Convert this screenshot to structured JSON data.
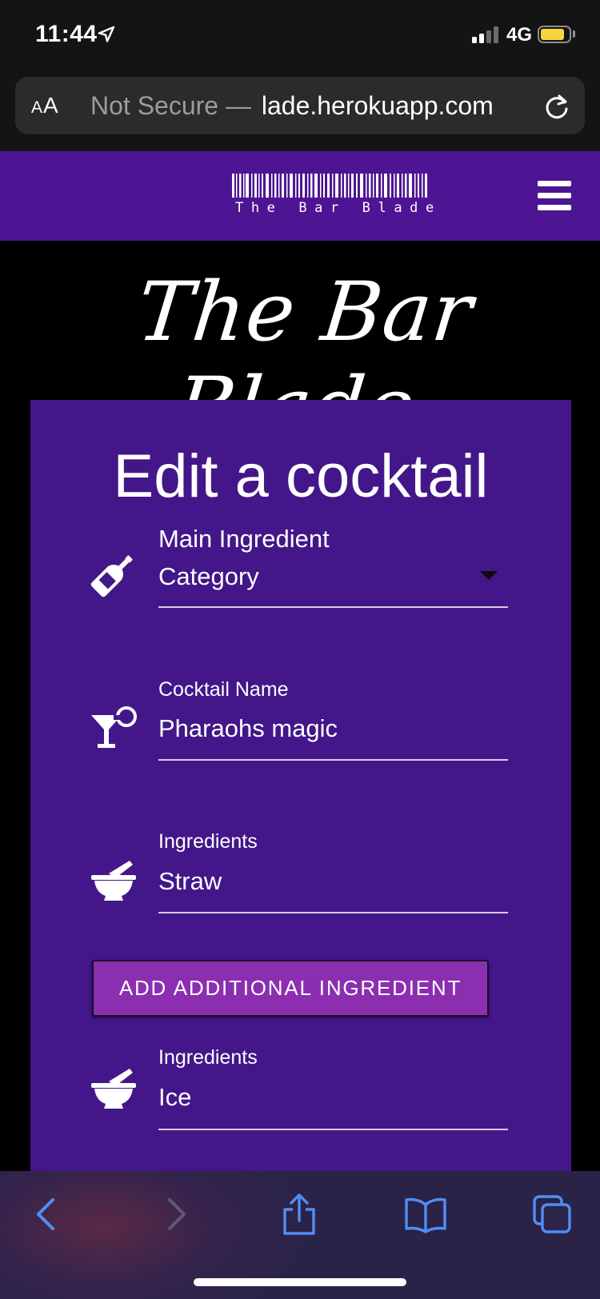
{
  "status_bar": {
    "time": "11:44",
    "network": "4G",
    "battery_color": "#f7d43c"
  },
  "browser": {
    "text_size_button": "AA",
    "url_prefix": "Not Secure —",
    "url_domain": "lade.herokuapp.com"
  },
  "navbar": {
    "logo_text": "The Bar Blade",
    "background": "#4d1593"
  },
  "hero": {
    "title": "The Bar Blade"
  },
  "form": {
    "title": "Edit a cocktail",
    "background": "#431789",
    "main_ingredient": {
      "label": "Main Ingredient",
      "selected_value": "Category",
      "icon": "wine-bottle-icon"
    },
    "cocktail_name": {
      "label": "Cocktail Name",
      "value": "Pharaohs magic",
      "icon": "cocktail-glass-icon"
    },
    "ingredients": [
      {
        "label": "Ingredients",
        "value": "Straw",
        "icon": "mortar-pestle-icon"
      },
      {
        "label": "Ingredients",
        "value": "Ice",
        "icon": "mortar-pestle-icon"
      }
    ],
    "add_button_label": "ADD ADDITIONAL INGREDIENT",
    "add_button_color": "#8b2fb0"
  },
  "toolbar": {
    "icons": [
      "back-icon",
      "forward-icon",
      "share-icon",
      "bookmarks-icon",
      "tabs-icon"
    ],
    "accent": "#4f8ef7"
  }
}
